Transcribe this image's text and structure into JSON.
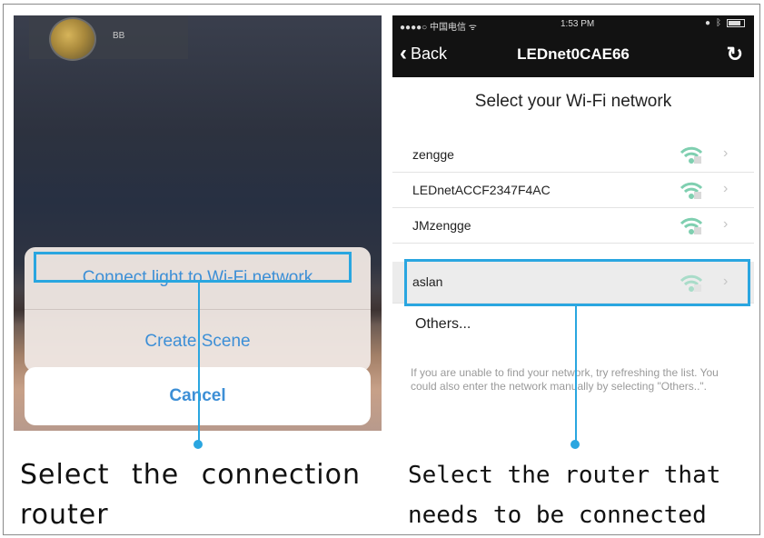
{
  "left_phone": {
    "badge_text": "BB",
    "sheet_items": [
      "Connect light to Wi-Fi network",
      "Create Scene"
    ],
    "cancel_label": "Cancel",
    "caption": "Select the connection router"
  },
  "right_phone": {
    "status_left": "●●●●○ 中国电信 ᯤ",
    "status_time": "1:53 PM",
    "nav": {
      "back_label": "Back",
      "title": "LEDnet0CAE66"
    },
    "heading": "Select your Wi-Fi network",
    "networks": [
      {
        "name": "zengge"
      },
      {
        "name": "LEDnetACCF2347F4AC"
      },
      {
        "name": "JMzengge"
      },
      {
        "name": "aslan"
      }
    ],
    "others_label": "Others...",
    "help_text": "If you are unable to find your network, try refreshing the list. You could also enter the network manually by selecting \"Others..\".",
    "caption": "Select the router that needs to be connected"
  },
  "colors": {
    "accent": "#2aa6e0",
    "sheet_text": "#3d8fd6",
    "wifi": "#7fcfb0"
  }
}
